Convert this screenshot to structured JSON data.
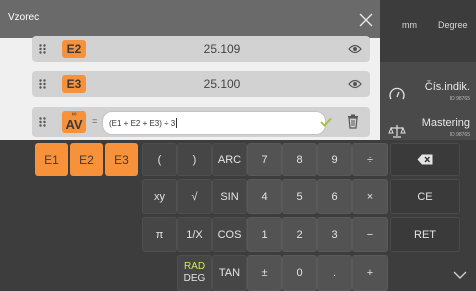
{
  "dialog": {
    "title": "Vzorec",
    "rows": [
      {
        "tag": "E2",
        "value": "25.109"
      },
      {
        "tag": "E3",
        "value": "25.100"
      }
    ],
    "formula_row": {
      "tag_symbol": "∞",
      "tag": "AV",
      "equals": "=",
      "formula": "(E1 + E2 + E3) ÷ 3"
    }
  },
  "right_panel": {
    "units": [
      "mm",
      "Degree"
    ],
    "items": [
      {
        "label": "Čís.indik.",
        "id": "ID 98765",
        "icon": "gauge-icon"
      },
      {
        "label": "Mastering",
        "id": "ID 98765",
        "icon": "scale-icon"
      }
    ]
  },
  "keyboard": {
    "variable_keys": [
      "E1",
      "E2",
      "E3"
    ],
    "row1": [
      "(",
      ")",
      "ARC",
      "7",
      "8",
      "9",
      "÷"
    ],
    "row2": [
      "xy",
      "√",
      "SIN",
      "4",
      "5",
      "6",
      "×"
    ],
    "row3": [
      "π",
      "1/X",
      "COS",
      "1",
      "2",
      "3",
      "−"
    ],
    "row4": {
      "rad": "RAD",
      "deg": "DEG",
      "tan": "TAN",
      "plusminus": "±",
      "zero": "0",
      "dot": ".",
      "plus": "+"
    },
    "right_keys": {
      "backspace_icon": "backspace-icon",
      "clear": "CE",
      "return": "RET",
      "collapse_icon": "chevron-down-icon"
    }
  },
  "colors": {
    "accent": "#f7923b",
    "rad_highlight": "#d7e85a"
  }
}
